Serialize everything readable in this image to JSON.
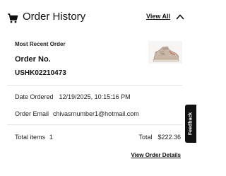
{
  "header": {
    "title": "Order History",
    "view_all_label": "View All",
    "icon": "cart-icon",
    "collapse_icon": "chevron-up-icon"
  },
  "order": {
    "section_label": "Most Recent Order",
    "order_no_label": "Order No.",
    "order_no_value": "USHK02210473",
    "product_icon": "shoe-thumbnail",
    "date_label": "Date Ordered",
    "date_value": "12/19/2025, 10:15:16 PM",
    "email_label": "Order Email",
    "email_value": "chivasrnumber1@hotmail.com",
    "total_items_label": "Total items",
    "total_items_value": "1",
    "total_label": "Total",
    "total_value": "$222.36",
    "details_link": "View Order Details"
  },
  "feedback": {
    "label": "Feedback"
  }
}
